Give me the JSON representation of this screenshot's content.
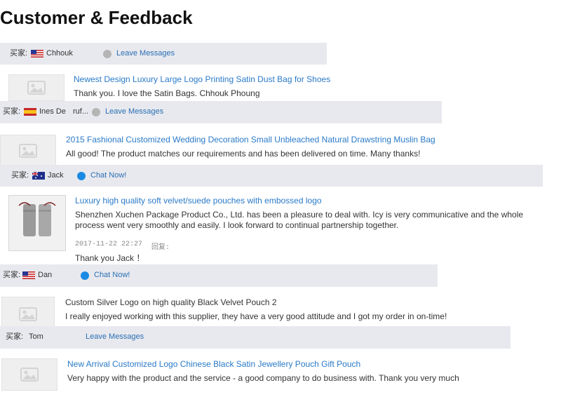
{
  "page": {
    "title": "Customer & Feedback"
  },
  "labels": {
    "buyer": "买家:",
    "reply": "回复:"
  },
  "colors": {
    "link": "#2a7ac8",
    "bar": "#e8e9ee",
    "chat_icon": "#1a8ae3",
    "leave_icon": "#b5b5b5"
  },
  "reviews": [
    {
      "product": "Newest Design Luxury Large Logo Printing Satin Dust Bag for Shoes",
      "text": "Thank you. I love the Satin Bags.   Chhouk Phoung",
      "buyer": {
        "name": "Chhouk",
        "flag": "us-flag-icon",
        "extra": ""
      },
      "action": {
        "label": "Leave Messages",
        "icon": "leave-message-icon"
      }
    },
    {
      "product": "2015 Fashional Customized Wedding Decoration Small Unbleached Natural Drawstring Muslin Bag",
      "text": "All good! The product matches our requirements and has been delivered on time. Many thanks!",
      "buyer": {
        "name": "Ines De",
        "flag": "es-flag-icon",
        "extra": "ruf..."
      },
      "action": {
        "label": "Leave Messages",
        "icon": "leave-message-icon"
      }
    },
    {
      "product": "Luxury high quality soft velvet/suede pouches with embossed logo",
      "text": "Shenzhen Xuchen Package Product Co., Ltd. has been a pleasure to deal with. Icy is very communicative and the whole process went very smoothly and easily. I look forward to continual partnership together.",
      "date": "2017-11-22 22:27",
      "reply_text": "Thank you Jack ！",
      "buyer": {
        "name": "Jack",
        "flag": "au-flag-icon",
        "extra": ""
      },
      "action": {
        "label": "Chat Now!",
        "icon": "chat-icon"
      }
    },
    {
      "product": "Custom Silver Logo on high quality Black Velvet Pouch 2",
      "text": "I really enjoyed working with this supplier, they have a very good attitude and I got my order in on-time!",
      "buyer": {
        "name": "Dan",
        "flag": "us-flag-icon",
        "extra": ""
      },
      "action": {
        "label": "Chat Now!",
        "icon": "chat-icon"
      }
    },
    {
      "product": "New Arrival Customized Logo Chinese Black Satin Jewellery Pouch Gift Pouch",
      "text": "Very happy with the product and the service - a good company to do business with. Thank you very much",
      "buyer": {
        "name": "Tom",
        "flag": "",
        "extra": ""
      },
      "action": {
        "label": "Leave Messages",
        "icon": "leave-message-icon"
      }
    }
  ]
}
